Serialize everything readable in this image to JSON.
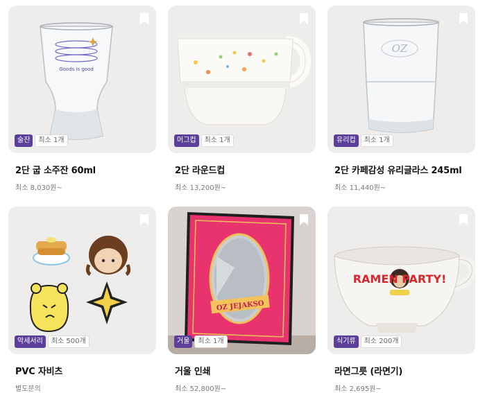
{
  "products": [
    {
      "category": "술잔",
      "min_qty": "최소 1개",
      "name": "2단 굽 소주잔 60ml",
      "price": "최소 8,030원~",
      "image_text": "Goods is good"
    },
    {
      "category": "머그컵",
      "min_qty": "최소 1개",
      "name": "2단 라운드컵",
      "price": "최소 13,200원~"
    },
    {
      "category": "유리컵",
      "min_qty": "최소 1개",
      "name": "2단 카페감성 유리글라스 245ml",
      "price": "최소 11,440원~",
      "image_text": "OZ"
    },
    {
      "category": "악세서리",
      "min_qty": "최소 500개",
      "name": "PVC 자비츠",
      "price": "별도문의"
    },
    {
      "category": "거울",
      "min_qty": "최소 1개",
      "name": "거울 인쇄",
      "price": "최소 52,800원~",
      "image_text": "OZ JEJAKSO"
    },
    {
      "category": "식기류",
      "min_qty": "최소 200개",
      "name": "라면그릇 (라면기)",
      "price": "최소 2,695원~",
      "image_text": "RAMEN PARTY!"
    }
  ],
  "colors": {
    "category_badge": "#5b3f98",
    "thumb_bg": "#efedeb"
  }
}
